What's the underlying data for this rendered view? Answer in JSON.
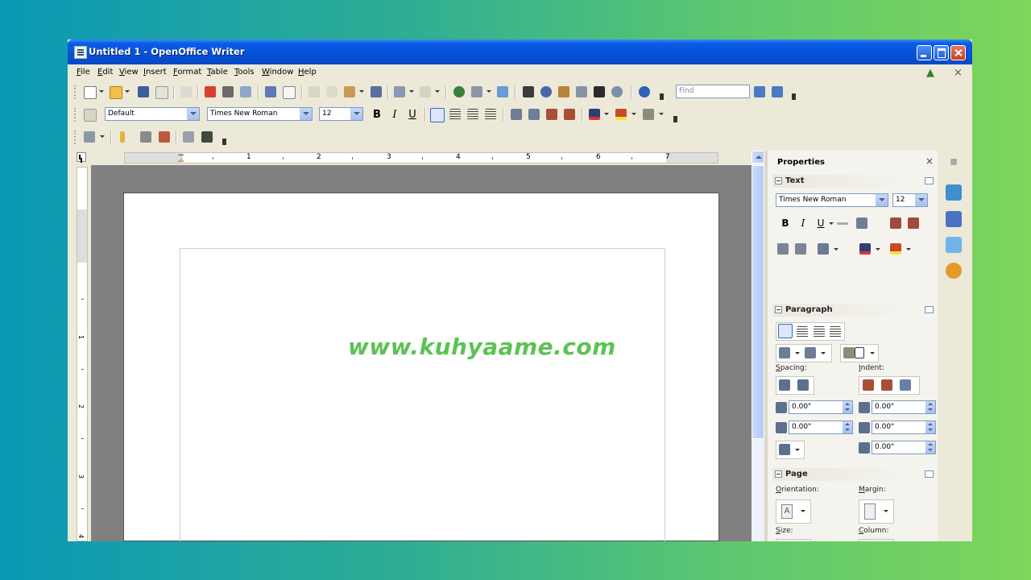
{
  "window": {
    "title": "Untitled 1 - OpenOffice Writer",
    "controls": [
      "minimize",
      "maximize",
      "close"
    ]
  },
  "menubar": {
    "items": [
      "File",
      "Edit",
      "View",
      "Insert",
      "Format",
      "Table",
      "Tools",
      "Window",
      "Help"
    ]
  },
  "toolbar": {
    "find_placeholder": "Find",
    "paragraph_style": "Default",
    "font_name": "Times New Roman",
    "font_size": "12",
    "bold_glyph": "B",
    "italic_glyph": "I",
    "underline_glyph": "U"
  },
  "ruler": {
    "h_numbers": [
      "1",
      "2",
      "3",
      "4",
      "5",
      "6",
      "7"
    ],
    "v_numbers": [
      "1",
      "2",
      "3",
      "4"
    ]
  },
  "properties_panel": {
    "title": "Properties",
    "text_section": {
      "title": "Text",
      "font_name": "Times New Roman",
      "font_size": "12"
    },
    "paragraph_section": {
      "title": "Paragraph",
      "spacing_label": "Spacing:",
      "indent_label": "Indent:",
      "above_spacing": "0.00\"",
      "below_spacing": "0.00\"",
      "before_indent": "0.00\"",
      "after_indent": "0.00\"",
      "first_line_indent": "0.00\""
    },
    "page_section": {
      "title": "Page",
      "orientation_label": "Orientation:",
      "margin_label": "Margin:",
      "size_label": "Size:",
      "column_label": "Column:"
    }
  },
  "watermark": "www.kuhyaame.com",
  "colors": {
    "titlebar": "#0551d8",
    "chrome": "#ece9d8",
    "document_bg": "#808080",
    "watermark": "#5cc254",
    "background_left": "#0a98b6",
    "background_right": "#7ed65a"
  }
}
